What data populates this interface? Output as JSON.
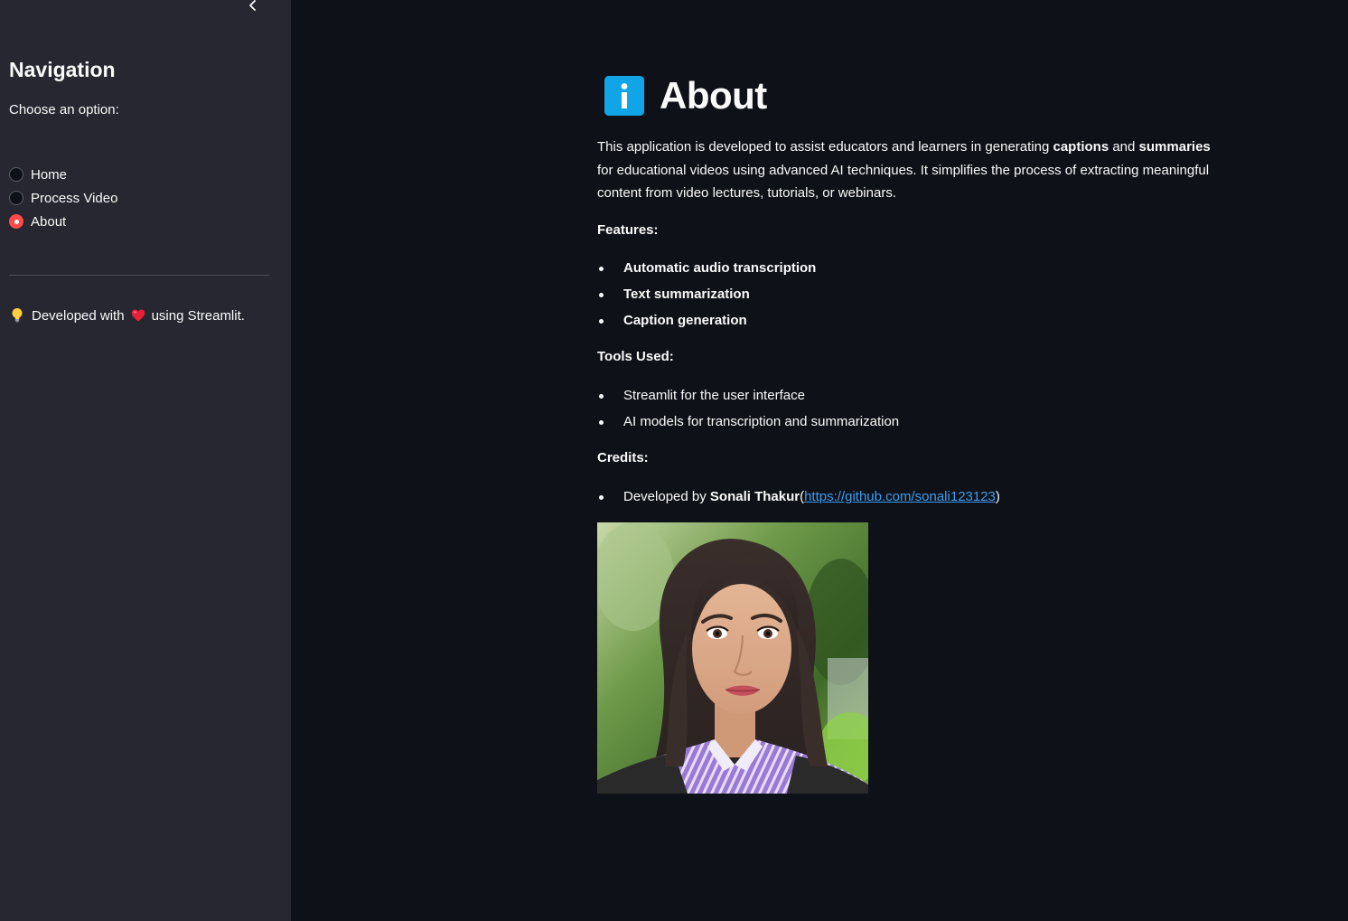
{
  "sidebar": {
    "title": "Navigation",
    "prompt": "Choose an option:",
    "options": [
      {
        "label": "Home",
        "selected": false
      },
      {
        "label": "Process Video",
        "selected": false
      },
      {
        "label": "About",
        "selected": true
      }
    ],
    "footer": {
      "prefix": "Developed with",
      "suffix": "using Streamlit.",
      "icons": [
        "lightbulb-icon",
        "heart-icon"
      ]
    }
  },
  "main": {
    "title": "About",
    "title_icon": "info-icon",
    "intro": {
      "part1": "This application is developed to assist educators and learners in generating ",
      "bold1": "captions",
      "part2": " and ",
      "bold2": "summaries",
      "part3": " for educational videos using advanced AI techniques. It simplifies the process of extracting meaningful content from video lectures, tutorials, or webinars."
    },
    "features_heading": "Features:",
    "features": [
      "Automatic audio transcription",
      "Text summarization",
      "Caption generation"
    ],
    "tools_heading": "Tools Used:",
    "tools": [
      "Streamlit for the user interface",
      "AI models for transcription and summarization"
    ],
    "credits_heading": "Credits:",
    "credit": {
      "prefix": "Developed by ",
      "name": "Sonali Thakur",
      "open": "(",
      "link": "https://github.com/sonali123123",
      "close": ")"
    }
  },
  "colors": {
    "sidebar_bg": "#262730",
    "main_bg": "#0e1117",
    "accent": "#ff4b4b",
    "link": "#3d9df3",
    "info_icon": "#11a5e8"
  }
}
